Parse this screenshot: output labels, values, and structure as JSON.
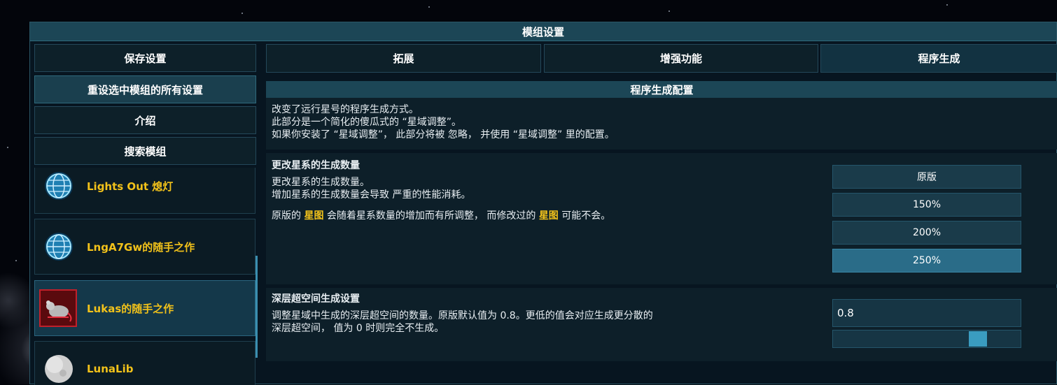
{
  "window": {
    "title": "模组设置"
  },
  "left": {
    "buttons": [
      "保存设置",
      "重设选中模组的所有设置",
      "介绍",
      "搜索模组"
    ],
    "mods": [
      {
        "name": "Lights Out 熄灯",
        "icon": "globe-icon"
      },
      {
        "name": "LngA7Gw的随手之作",
        "icon": "globe-icon"
      },
      {
        "name": "Lukas的随手之作",
        "icon": "rat-icon"
      },
      {
        "name": "LunaLib",
        "icon": "moon-icon"
      }
    ]
  },
  "tabs": [
    "拓展",
    "增强功能",
    "程序生成"
  ],
  "active_tab": "程序生成",
  "config": {
    "title": "程序生成配置",
    "intro": [
      "改变了远行星号的程序生成方式。",
      "此部分是一个简化的傻瓜式的 “星域调整”。",
      "如果你安装了 “星域调整”， 此部分将被 忽略， 并使用 “星域调整” 里的配置。"
    ],
    "systems": {
      "heading": "更改星系的生成数量",
      "lines": [
        "更改星系的生成数量。",
        "增加星系的生成数量会导致 严重的性能消耗。"
      ],
      "note_prefix": "原版的 ",
      "note_hl1": "星图",
      "note_mid": " 会随着星系数量的增加而有所调整， 而修改过的 ",
      "note_hl2": "星图",
      "note_suffix": " 可能不会。",
      "options": [
        "原版",
        "150%",
        "200%",
        "250%"
      ],
      "selected": "250%"
    },
    "hyperspace": {
      "heading": "深层超空间生成设置",
      "lines": [
        "调整星域中生成的深层超空间的数量。原版默认值为 0.8。更低的值会对应生成更分散的",
        "深层超空间， 值为 0 时则完全不生成。"
      ],
      "value": "0.8",
      "slider_fraction": 0.8
    }
  }
}
